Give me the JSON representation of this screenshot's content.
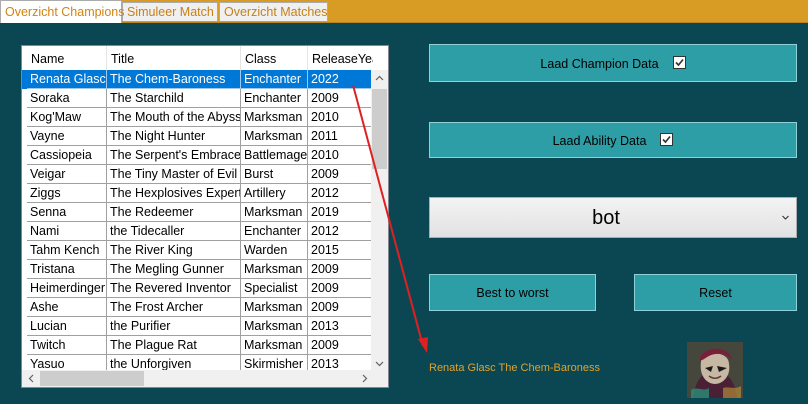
{
  "tabs": [
    {
      "label": "Overzicht Champions",
      "active": true
    },
    {
      "label": "Simuleer Match",
      "active": false
    },
    {
      "label": "Overzicht Matches",
      "active": false
    }
  ],
  "table": {
    "columns": [
      "Name",
      "Title",
      "Class",
      "ReleaseYear"
    ],
    "rows": [
      [
        "Renata Glasc",
        "The Chem-Baroness",
        "Enchanter",
        "2022"
      ],
      [
        "Soraka",
        "The Starchild",
        "Enchanter",
        "2009"
      ],
      [
        "Kog'Maw",
        "The Mouth of the Abyss",
        "Marksman",
        "2010"
      ],
      [
        "Vayne",
        "The Night Hunter",
        "Marksman",
        "2011"
      ],
      [
        "Cassiopeia",
        "The Serpent's Embrace",
        "Battlemage",
        "2010"
      ],
      [
        "Veigar",
        "The Tiny Master of Evil",
        "Burst",
        "2009"
      ],
      [
        "Ziggs",
        "The Hexplosives Expert",
        "Artillery",
        "2012"
      ],
      [
        "Senna",
        "The Redeemer",
        "Marksman",
        "2019"
      ],
      [
        "Nami",
        "the Tidecaller",
        "Enchanter",
        "2012"
      ],
      [
        "Tahm Kench",
        "The River King",
        "Warden",
        "2015"
      ],
      [
        "Tristana",
        "The Megling Gunner",
        "Marksman",
        "2009"
      ],
      [
        "Heimerdinger",
        "The Revered Inventor",
        "Specialist",
        "2009"
      ],
      [
        "Ashe",
        "The Frost Archer",
        "Marksman",
        "2009"
      ],
      [
        "Lucian",
        "the Purifier",
        "Marksman",
        "2013"
      ],
      [
        "Twitch",
        "The Plague Rat",
        "Marksman",
        "2009"
      ],
      [
        "Yasuo",
        "the Unforgiven",
        "Skirmisher",
        "2013"
      ]
    ],
    "selected_index": 0
  },
  "buttons": {
    "load_champion": "Laad Champion Data",
    "load_ability": "Laad Ability Data",
    "best_to_worst": "Best to worst",
    "reset": "Reset"
  },
  "checks": {
    "load_champion": true,
    "load_ability": true
  },
  "combo": {
    "value": "bot"
  },
  "selection_label": "Renata Glasc The Chem-Baroness",
  "colors": {
    "background": "#0b4752",
    "button": "#2e9ea6",
    "tabbar": "#d89c24",
    "selection": "#0078d7",
    "annotation_arrow": "#e02020",
    "label_text": "#e0a22d"
  },
  "icons": [
    "check-icon",
    "chevron-down-icon",
    "scroll-up-icon",
    "scroll-down-icon",
    "scroll-left-icon",
    "scroll-right-icon",
    "champion-portrait"
  ]
}
